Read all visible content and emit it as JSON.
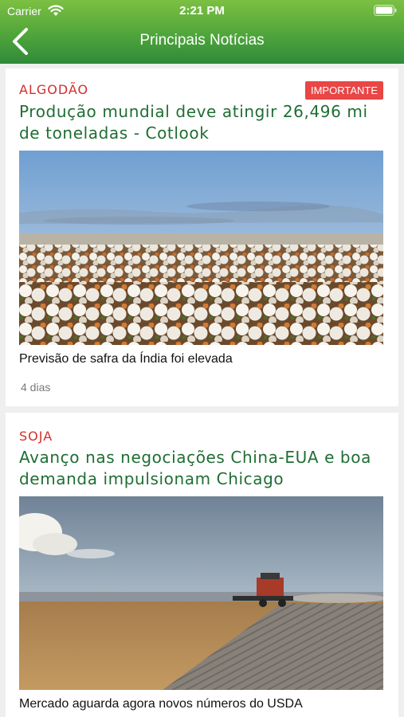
{
  "status_bar": {
    "carrier": "Carrier",
    "time": "2:21 PM"
  },
  "nav": {
    "title": "Principais Notícias",
    "back_icon": "chevron-left-icon"
  },
  "colors": {
    "header_top": "#7cc042",
    "header_bottom": "#2f8a3a",
    "category": "#d0302b",
    "headline": "#1f6e34",
    "badge": "#e94646"
  },
  "news": [
    {
      "category": "ALGODÃO",
      "badge": "IMPORTANTE",
      "headline": "Produção mundial deve atingir 26,496 mi de toneladas - Cotlook",
      "image": "cotton-field-photo",
      "caption": "Previsão de safra da Índia foi elevada",
      "age": "4 dias"
    },
    {
      "category": "SOJA",
      "headline": "Avanço nas negociações China-EUA e boa demanda impulsionam Chicago",
      "image": "combine-harvester-photo",
      "caption": "Mercado aguarda agora novos números do USDA"
    }
  ]
}
